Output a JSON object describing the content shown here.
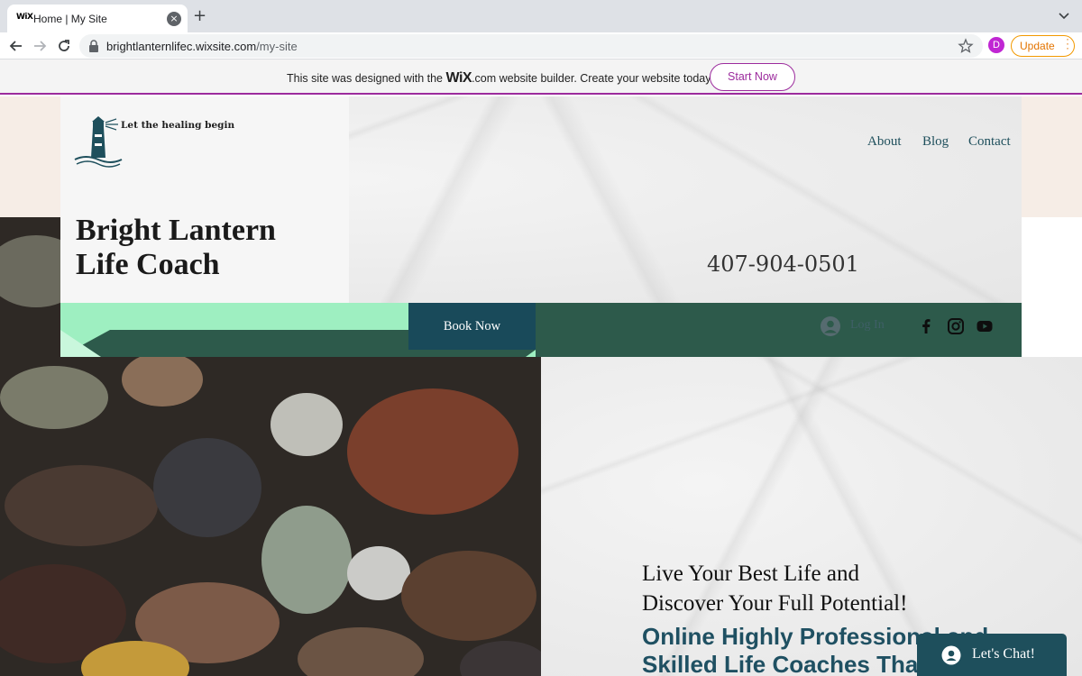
{
  "browser": {
    "tab_favicon": "WiX",
    "tab_title": "Home | My Site",
    "tab_close": "×",
    "new_tab": "+",
    "url_host": "brightlanternlifec.wixsite.com",
    "url_path": "/my-site",
    "profile_initial": "D",
    "update_label": "Update"
  },
  "wix_banner": {
    "text_before": "This site was designed with the ",
    "logo": "WiX",
    "text_after": ".com website builder. Create your website today.",
    "start_now": "Start Now"
  },
  "header": {
    "tagline": "Let the healing begin",
    "nav": [
      "About",
      "Blog",
      "Contact"
    ],
    "title_line1": "Bright Lantern",
    "title_line2": "Life Coach",
    "phone": "407-904-0501",
    "book_now": "Book Now",
    "login": "Log In"
  },
  "hero": {
    "headline_line1": "Live Your Best Life and",
    "headline_line2": "Discover Your Full Potential!",
    "subhead_line1": "Online Highly Professional and",
    "subhead_line2": "Skilled Life Coaches That"
  },
  "chat": {
    "label": "Let's Chat!"
  },
  "icons": {
    "back": "arrow-left-icon",
    "forward": "arrow-right-icon",
    "reload": "reload-icon",
    "lock": "lock-icon",
    "star": "star-icon",
    "menu": "more-vert-icon",
    "social": [
      "facebook-icon",
      "instagram-icon",
      "youtube-icon"
    ],
    "login_avatar": "user-avatar-icon",
    "chat": "chat-bubble-icon"
  },
  "colors": {
    "brand_teal": "#1e4f5c",
    "strip_green": "#2d5a4b",
    "mint": "#9eefc1",
    "wix_purple": "#9c2b9d",
    "peach": "#f6ede6"
  }
}
